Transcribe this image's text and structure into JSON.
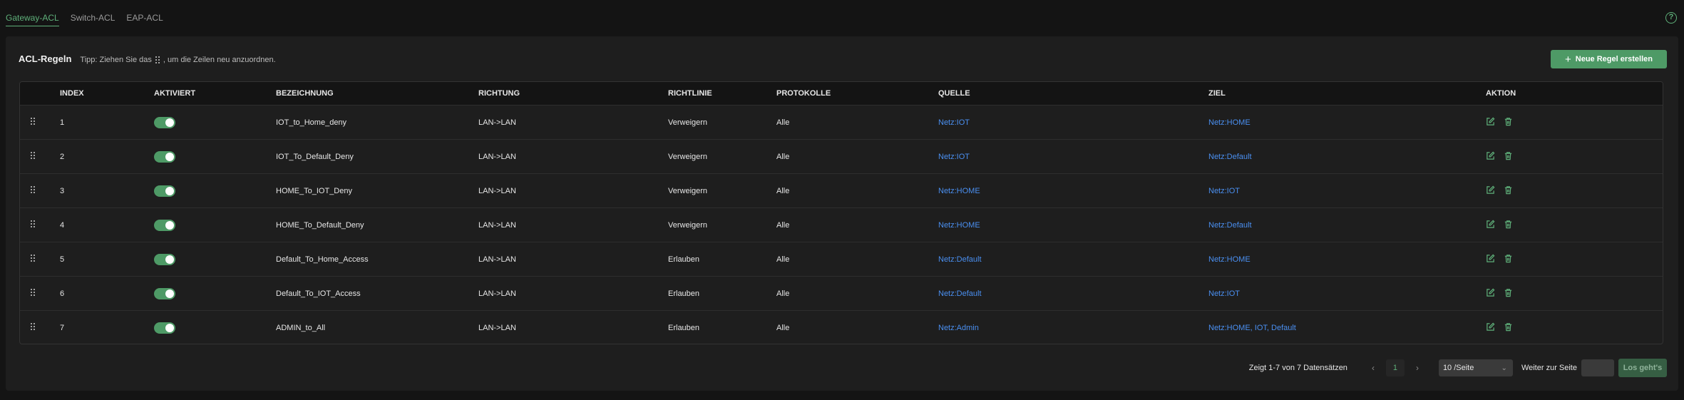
{
  "tabs": [
    {
      "label": "Gateway-ACL",
      "active": true
    },
    {
      "label": "Switch-ACL",
      "active": false
    },
    {
      "label": "EAP-ACL",
      "active": false
    }
  ],
  "help_icon": "question-circle-icon",
  "card": {
    "title": "ACL-Regeln",
    "tip_before": "Tipp: Ziehen Sie das",
    "tip_after": ", um die Zeilen neu anzuordnen.",
    "new_button": "Neue Regel erstellen"
  },
  "columns": {
    "index": "INDEX",
    "enabled": "AKTIVIERT",
    "name": "BEZEICHNUNG",
    "direction": "RICHTUNG",
    "policy": "RICHTLINIE",
    "protocols": "PROTOKOLLE",
    "source": "QUELLE",
    "target": "ZIEL",
    "action": "AKTION"
  },
  "rows": [
    {
      "index": "1",
      "enabled": true,
      "name": "IOT_to_Home_deny",
      "direction": "LAN->LAN",
      "policy": "Verweigern",
      "protocols": "Alle",
      "source": "Netz:IOT",
      "target": "Netz:HOME"
    },
    {
      "index": "2",
      "enabled": true,
      "name": "IOT_To_Default_Deny",
      "direction": "LAN->LAN",
      "policy": "Verweigern",
      "protocols": "Alle",
      "source": "Netz:IOT",
      "target": "Netz:Default"
    },
    {
      "index": "3",
      "enabled": true,
      "name": "HOME_To_IOT_Deny",
      "direction": "LAN->LAN",
      "policy": "Verweigern",
      "protocols": "Alle",
      "source": "Netz:HOME",
      "target": "Netz:IOT"
    },
    {
      "index": "4",
      "enabled": true,
      "name": "HOME_To_Default_Deny",
      "direction": "LAN->LAN",
      "policy": "Verweigern",
      "protocols": "Alle",
      "source": "Netz:HOME",
      "target": "Netz:Default"
    },
    {
      "index": "5",
      "enabled": true,
      "name": "Default_To_Home_Access",
      "direction": "LAN->LAN",
      "policy": "Erlauben",
      "protocols": "Alle",
      "source": "Netz:Default",
      "target": "Netz:HOME"
    },
    {
      "index": "6",
      "enabled": true,
      "name": "Default_To_IOT_Access",
      "direction": "LAN->LAN",
      "policy": "Erlauben",
      "protocols": "Alle",
      "source": "Netz:Default",
      "target": "Netz:IOT"
    },
    {
      "index": "7",
      "enabled": true,
      "name": "ADMIN_to_All",
      "direction": "LAN->LAN",
      "policy": "Erlauben",
      "protocols": "Alle",
      "source": "Netz:Admin",
      "target": "Netz:HOME, IOT, Default"
    }
  ],
  "pagination": {
    "summary": "Zeigt 1-7 von 7 Datensätzen",
    "current_page": "1",
    "page_size": "10 /Seite",
    "goto_label": "Weiter zur Seite",
    "goto_value": "",
    "go_button": "Los geht's"
  },
  "colors": {
    "accent": "#5fb07a",
    "button": "#4e9a66",
    "link": "#4a8ff0"
  }
}
